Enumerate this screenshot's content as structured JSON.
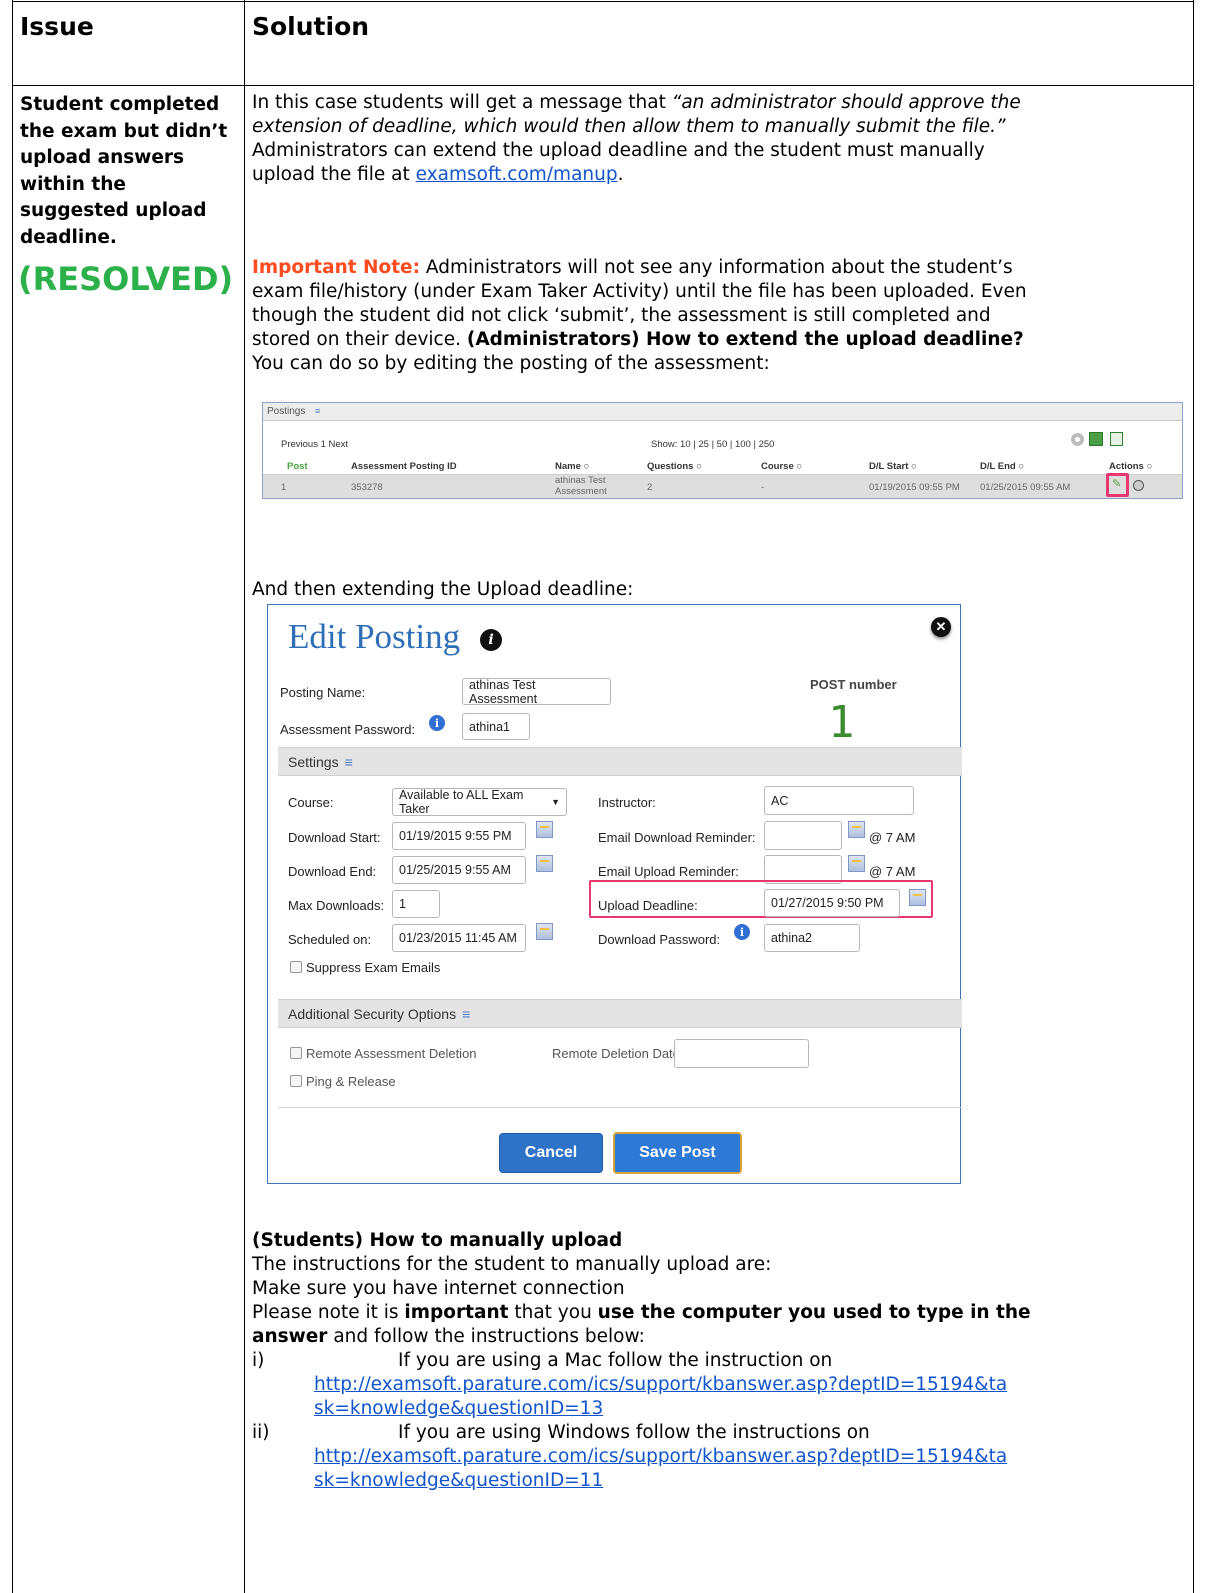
{
  "table": {
    "col_issue": "Issue",
    "col_solution": "Solution"
  },
  "issue": {
    "lines": [
      "Student completed",
      "the exam but didn’t",
      "upload answers",
      "within the",
      "suggested upload",
      "deadline."
    ],
    "status": "(RESOLVED)"
  },
  "solution": {
    "p1_line1_plain": "In this case students will get a message that ",
    "p1_line1_italic": "“an administrator should approve the",
    "p1_line2_italic": "extension of deadline, which would then allow them to manually submit the file.”",
    "p1_line3": "Administrators can extend the upload deadline and the student must manually",
    "p1_line4_plain": "upload the file at ",
    "p1_link": "examsoft.com/manup",
    "p1_line4_end": ".",
    "note_label": "Important Note:",
    "note_line1_rest": " Administrators will not see any information about the student’s",
    "note_line2": "exam file/history (under Exam Taker Activity) until the file has been uploaded. Even",
    "note_line3": "though the student did not click ‘submit’, the assessment is still completed and",
    "note_line4_plain": "stored on their device. ",
    "note_line4_bold": "(Administrators) How to extend the upload deadline?",
    "note_line5": "You can do so by editing the posting of the assessment:",
    "then_text": "And then extending the Upload deadline:",
    "students_heading": "(Students) How to manually upload",
    "s_line1": "The instructions for the student to manually upload are:",
    "s_line2": "Make sure you have internet connection",
    "s_line3_a": "Please note it is ",
    "s_line3_b": "important",
    "s_line3_c": " that you ",
    "s_line3_d": "use the computer you used to type in the",
    "s_line4_a": "answer",
    "s_line4_b": " and follow the instructions below:",
    "item1_num": "i)",
    "item1_text": "If you are using a Mac follow the instruction on",
    "item1_link_1": "http://examsoft.parature.com/ics/support/kbanswer.asp?deptID=15194&ta",
    "item1_link_2": "sk=knowledge&questionID=13",
    "item2_num": "ii)",
    "item2_text": "If you are using Windows follow the instructions on",
    "item2_link_1": "http://examsoft.parature.com/ics/support/kbanswer.asp?deptID=15194&ta",
    "item2_link_2": "sk=knowledge&questionID=11"
  },
  "postings": {
    "title": "Postings",
    "pager": "Previous 1 Next",
    "show": "Show: 10 | 25 | 50 | 100 | 250",
    "headers": [
      "Post",
      "Assessment Posting ID",
      "Name ○",
      "Questions ○",
      "Course ○",
      "D/L Start ○",
      "D/L End ○",
      "Actions ○"
    ],
    "row": [
      "1",
      "353278",
      "athinas Test",
      "Assessment",
      "2",
      "-",
      "01/19/2015 09:55 PM",
      "01/25/2015 09:55 AM"
    ]
  },
  "dialog": {
    "title": "Edit Posting",
    "post_number_label": "POST number",
    "post_number": "1",
    "posting_name_label": "Posting Name:",
    "posting_name": "athinas Test Assessment",
    "password_label": "Assessment Password:",
    "password": "athina1",
    "settings_label": "Settings",
    "course_label": "Course:",
    "course": "Available to ALL Exam Taker",
    "instructor_label": "Instructor:",
    "instructor": "AC",
    "dl_start_label": "Download Start:",
    "dl_start": "01/19/2015 9:55 PM",
    "email_dl_label": "Email Download Reminder:",
    "at7_1": "@ 7 AM",
    "dl_end_label": "Download End:",
    "dl_end": "01/25/2015 9:55 AM",
    "email_ul_label": "Email Upload Reminder:",
    "at7_2": "@ 7 AM",
    "max_dl_label": "Max Downloads:",
    "max_dl": "1",
    "upload_deadline_label": "Upload Deadline:",
    "upload_deadline": "01/27/2015 9:50 PM",
    "scheduled_label": "Scheduled on:",
    "scheduled": "01/23/2015 11:45 AM",
    "dl_password_label": "Download Password:",
    "dl_password": "athina2",
    "suppress_label": "Suppress Exam Emails",
    "security_label": "Additional Security Options",
    "remote_del_label": "Remote Assessment Deletion",
    "remote_date_label": "Remote Deletion Date:",
    "ping_label": "Ping & Release",
    "cancel": "Cancel",
    "save": "Save Post"
  },
  "colors": {
    "resolved": "#2bb04a",
    "important": "#ff4b1f",
    "link": "#1155cc",
    "highlight": "#e8376e",
    "cancel_btn": "#2f73c9",
    "save_btn": "#2e79d6"
  }
}
